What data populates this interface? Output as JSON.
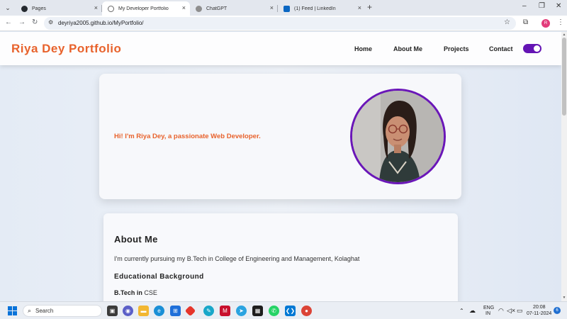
{
  "browser": {
    "tabs": [
      {
        "label": "Pages",
        "favicon": "github-icon",
        "active": false
      },
      {
        "label": "My Developer Portfolio",
        "favicon": "globe-icon",
        "active": true
      },
      {
        "label": "ChatGPT",
        "favicon": "chatgpt-icon",
        "active": false
      },
      {
        "label": "(1) Feed | LinkedIn",
        "favicon": "linkedin-icon",
        "active": false
      }
    ],
    "url": "deyriya2005.github.io/MyPortfolio/",
    "profile_initial": "R"
  },
  "site": {
    "logo": "Riya Dey Portfolio",
    "nav": [
      "Home",
      "About Me",
      "Projects",
      "Contact"
    ],
    "theme_toggle_on": true,
    "accent_color": "#e8622c",
    "toggle_color": "#6414b4",
    "hero": {
      "greeting": "Hi! I'm Riya Dey, a passionate Web Developer."
    },
    "about": {
      "title": "About Me",
      "text": "I'm currently pursuing my B.Tech in College of Engineering and Management, Kolaghat",
      "edu_title": "Educational Background",
      "degree_label": "B.Tech in",
      "degree_value": "CSE"
    }
  },
  "taskbar": {
    "search_label": "Search",
    "lang_line1": "ENG",
    "lang_line2": "IN",
    "time": "20:08",
    "date": "07-11-2024",
    "notification_count": "6"
  }
}
